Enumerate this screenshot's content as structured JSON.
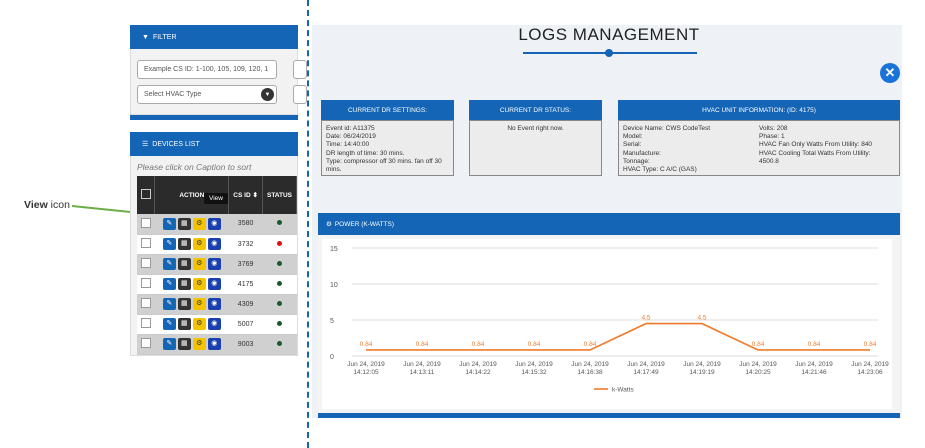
{
  "callout": {
    "bold": "View",
    "rest": "icon"
  },
  "filter": {
    "title": "FILTER",
    "cs_placeholder": "Example CS ID: 1-100, 105, 109, 120, 1",
    "hvac_select": "Select HVAC Type"
  },
  "devices": {
    "title": "DEVICES LIST",
    "hint": "Please click on Caption to sort",
    "columns": {
      "action": "ACTION",
      "csid": "CS ID ⬍",
      "status": "STATUS"
    },
    "tooltip": "View",
    "rows": [
      {
        "csid": "3580",
        "status_color": "#1a5a2a"
      },
      {
        "csid": "3732",
        "status_color": "#e01010"
      },
      {
        "csid": "3769",
        "status_color": "#1a5a2a"
      },
      {
        "csid": "4175",
        "status_color": "#1a5a2a"
      },
      {
        "csid": "4309",
        "status_color": "#1a5a2a"
      },
      {
        "csid": "5007",
        "status_color": "#1a5a2a"
      },
      {
        "csid": "9003",
        "status_color": "#1a5a2a"
      }
    ]
  },
  "main": {
    "title": "LOGS MANAGEMENT",
    "close_icon": "close-icon",
    "dr_settings": {
      "title": "CURRENT DR SETTINGS:",
      "lines": [
        "Event id: A11375",
        "Date: 06/24/2019",
        "Time: 14:40:00",
        "DR length of time: 30 mins.",
        "Type: compressor off 30 mins. fan off 30 mins."
      ]
    },
    "dr_status": {
      "title": "CURRENT DR STATUS:",
      "text": "No Event right now."
    },
    "hvac_info": {
      "title": "HVAC UNIT INFORMATION: (ID: 4175)",
      "left": [
        "Device Name: CWS CodeTest",
        "Model:",
        "Serial:",
        "Manufacture:",
        "Tonnage:",
        "HVAC Type: C A/C (GAS)"
      ],
      "right": [
        "Volts: 208",
        "Phase: 1",
        "HVAC Fan Only Watts From Utility: 840",
        "HVAC Cooling Total Watts From Utility:",
        "4500.8"
      ]
    },
    "power": {
      "title": "POWER (K-WATTS)"
    }
  },
  "chart_data": {
    "type": "line",
    "x": [
      "Jun 24, 2019 14:12:05",
      "Jun 24, 2019 14:13:11",
      "Jun 24, 2019 14:14:22",
      "Jun 24, 2019 14:15:32",
      "Jun 24, 2019 14:16:38",
      "Jun 24, 2019 14:17:49",
      "Jun 24, 2019 14:19:19",
      "Jun 24, 2019 14:20:25",
      "Jun 24, 2019 14:21:46",
      "Jun 24, 2019 14:23:06"
    ],
    "series": [
      {
        "name": "k-Watts",
        "values": [
          0.84,
          0.84,
          0.84,
          0.84,
          0.84,
          4.5,
          4.5,
          0.84,
          0.84,
          0.84
        ]
      }
    ],
    "ylim": [
      0,
      15
    ],
    "yticks": [
      0,
      5,
      10,
      15
    ],
    "grid": true,
    "legend": "bottom-center",
    "color": "#f07a2a"
  }
}
